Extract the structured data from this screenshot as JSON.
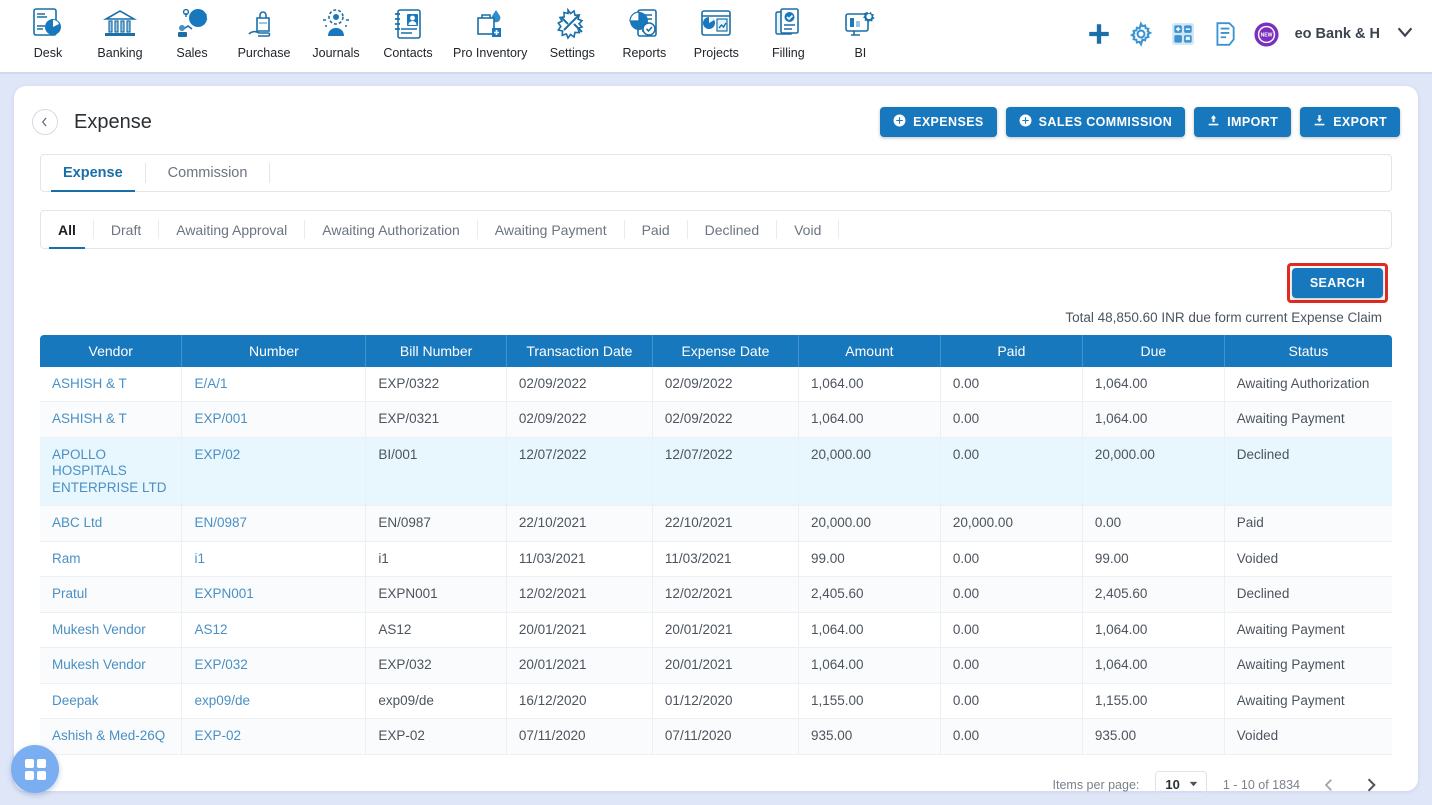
{
  "topnav": {
    "items": [
      {
        "label": "Desk",
        "icon": "dashboard-icon"
      },
      {
        "label": "Banking",
        "icon": "bank-icon"
      },
      {
        "label": "Sales",
        "icon": "sales-icon"
      },
      {
        "label": "Purchase",
        "icon": "purchase-icon"
      },
      {
        "label": "Journals",
        "icon": "journals-icon"
      },
      {
        "label": "Contacts",
        "icon": "contacts-icon"
      },
      {
        "label": "Pro Inventory",
        "icon": "inventory-icon"
      },
      {
        "label": "Settings",
        "icon": "settings-icon"
      },
      {
        "label": "Reports",
        "icon": "reports-icon"
      },
      {
        "label": "Projects",
        "icon": "projects-icon"
      },
      {
        "label": "Filling",
        "icon": "filling-icon"
      },
      {
        "label": "BI",
        "icon": "bi-icon"
      }
    ],
    "right_icons": [
      {
        "name": "add-icon",
        "color": "#1b6fa8"
      },
      {
        "name": "gear-icon",
        "color": "#2f8ec9"
      },
      {
        "name": "calculator-icon",
        "color": "#2f8ec9"
      },
      {
        "name": "notes-icon",
        "color": "#2f8ec9"
      },
      {
        "name": "new-badge-icon",
        "color": "#7b2fbe",
        "text": "NEW"
      }
    ],
    "org_name": "eo Bank & H",
    "chevron": "chevron-down-icon"
  },
  "page": {
    "back": "back-icon",
    "title": "Expense",
    "actions": [
      {
        "label": "EXPENSES",
        "icon": "plus-circle-icon"
      },
      {
        "label": "SALES COMMISSION",
        "icon": "plus-circle-icon"
      },
      {
        "label": "IMPORT",
        "icon": "upload-icon"
      },
      {
        "label": "EXPORT",
        "icon": "download-icon"
      }
    ]
  },
  "tabs": {
    "items": [
      {
        "label": "Expense",
        "active": true
      },
      {
        "label": "Commission",
        "active": false
      }
    ]
  },
  "filters": {
    "items": [
      {
        "label": "All",
        "active": true
      },
      {
        "label": "Draft",
        "active": false
      },
      {
        "label": "Awaiting Approval",
        "active": false
      },
      {
        "label": "Awaiting Authorization",
        "active": false
      },
      {
        "label": "Awaiting Payment",
        "active": false
      },
      {
        "label": "Paid",
        "active": false
      },
      {
        "label": "Declined",
        "active": false
      },
      {
        "label": "Void",
        "active": false
      }
    ]
  },
  "search": {
    "button_label": "SEARCH",
    "highlight_color": "#e02b20"
  },
  "total_line": "Total 48,850.60 INR due form current Expense Claim",
  "table": {
    "columns": [
      "Vendor",
      "Number",
      "Bill Number",
      "Transaction Date",
      "Expense Date",
      "Amount",
      "Paid",
      "Due",
      "Status"
    ],
    "rows": [
      {
        "vendor": "ASHISH & T",
        "number": "E/A/1",
        "bill_number": "EXP/0322",
        "transaction_date": "02/09/2022",
        "expense_date": "02/09/2022",
        "amount": "1,064.00",
        "paid": "0.00",
        "due": "1,064.00",
        "status": "Awaiting Authorization",
        "style": ""
      },
      {
        "vendor": "ASHISH & T",
        "number": "EXP/001",
        "bill_number": "EXP/0321",
        "transaction_date": "02/09/2022",
        "expense_date": "02/09/2022",
        "amount": "1,064.00",
        "paid": "0.00",
        "due": "1,064.00",
        "status": "Awaiting Payment",
        "style": "alt"
      },
      {
        "vendor": "APOLLO HOSPITALS ENTERPRISE LTD",
        "number": "EXP/02",
        "bill_number": "BI/001",
        "transaction_date": "12/07/2022",
        "expense_date": "12/07/2022",
        "amount": "20,000.00",
        "paid": "0.00",
        "due": "20,000.00",
        "status": "Declined",
        "style": "sel"
      },
      {
        "vendor": "ABC Ltd",
        "number": "EN/0987",
        "bill_number": "EN/0987",
        "transaction_date": "22/10/2021",
        "expense_date": "22/10/2021",
        "amount": "20,000.00",
        "paid": "20,000.00",
        "due": "0.00",
        "status": "Paid",
        "style": "alt"
      },
      {
        "vendor": "Ram",
        "number": "i1",
        "bill_number": "i1",
        "transaction_date": "11/03/2021",
        "expense_date": "11/03/2021",
        "amount": "99.00",
        "paid": "0.00",
        "due": "99.00",
        "status": "Voided",
        "style": ""
      },
      {
        "vendor": "Pratul",
        "number": "EXPN001",
        "bill_number": "EXPN001",
        "transaction_date": "12/02/2021",
        "expense_date": "12/02/2021",
        "amount": "2,405.60",
        "paid": "0.00",
        "due": "2,405.60",
        "status": "Declined",
        "style": "alt"
      },
      {
        "vendor": "Mukesh Vendor",
        "number": "AS12",
        "bill_number": "AS12",
        "transaction_date": "20/01/2021",
        "expense_date": "20/01/2021",
        "amount": "1,064.00",
        "paid": "0.00",
        "due": "1,064.00",
        "status": "Awaiting Payment",
        "style": ""
      },
      {
        "vendor": "Mukesh Vendor",
        "number": "EXP/032",
        "bill_number": "EXP/032",
        "transaction_date": "20/01/2021",
        "expense_date": "20/01/2021",
        "amount": "1,064.00",
        "paid": "0.00",
        "due": "1,064.00",
        "status": "Awaiting Payment",
        "style": "alt"
      },
      {
        "vendor": "Deepak",
        "number": "exp09/de",
        "bill_number": "exp09/de",
        "transaction_date": "16/12/2020",
        "expense_date": "01/12/2020",
        "amount": "1,155.00",
        "paid": "0.00",
        "due": "1,155.00",
        "status": "Awaiting Payment",
        "style": ""
      },
      {
        "vendor": "Ashish & Med-26Q",
        "number": "EXP-02",
        "bill_number": "EXP-02",
        "transaction_date": "07/11/2020",
        "expense_date": "07/11/2020",
        "amount": "935.00",
        "paid": "0.00",
        "due": "935.00",
        "status": "Voided",
        "style": "alt"
      }
    ]
  },
  "pagination": {
    "items_per_page_label": "Items per page:",
    "items_per_page_value": "10",
    "range": "1 - 10 of 1834",
    "prev_icon": "chevron-left-icon",
    "next_icon": "chevron-right-icon"
  },
  "fab": {
    "icon": "apps-grid-icon"
  },
  "colors": {
    "accent": "#1878bd",
    "link": "#4a90c4",
    "page_bg": "#dfe6f8"
  }
}
